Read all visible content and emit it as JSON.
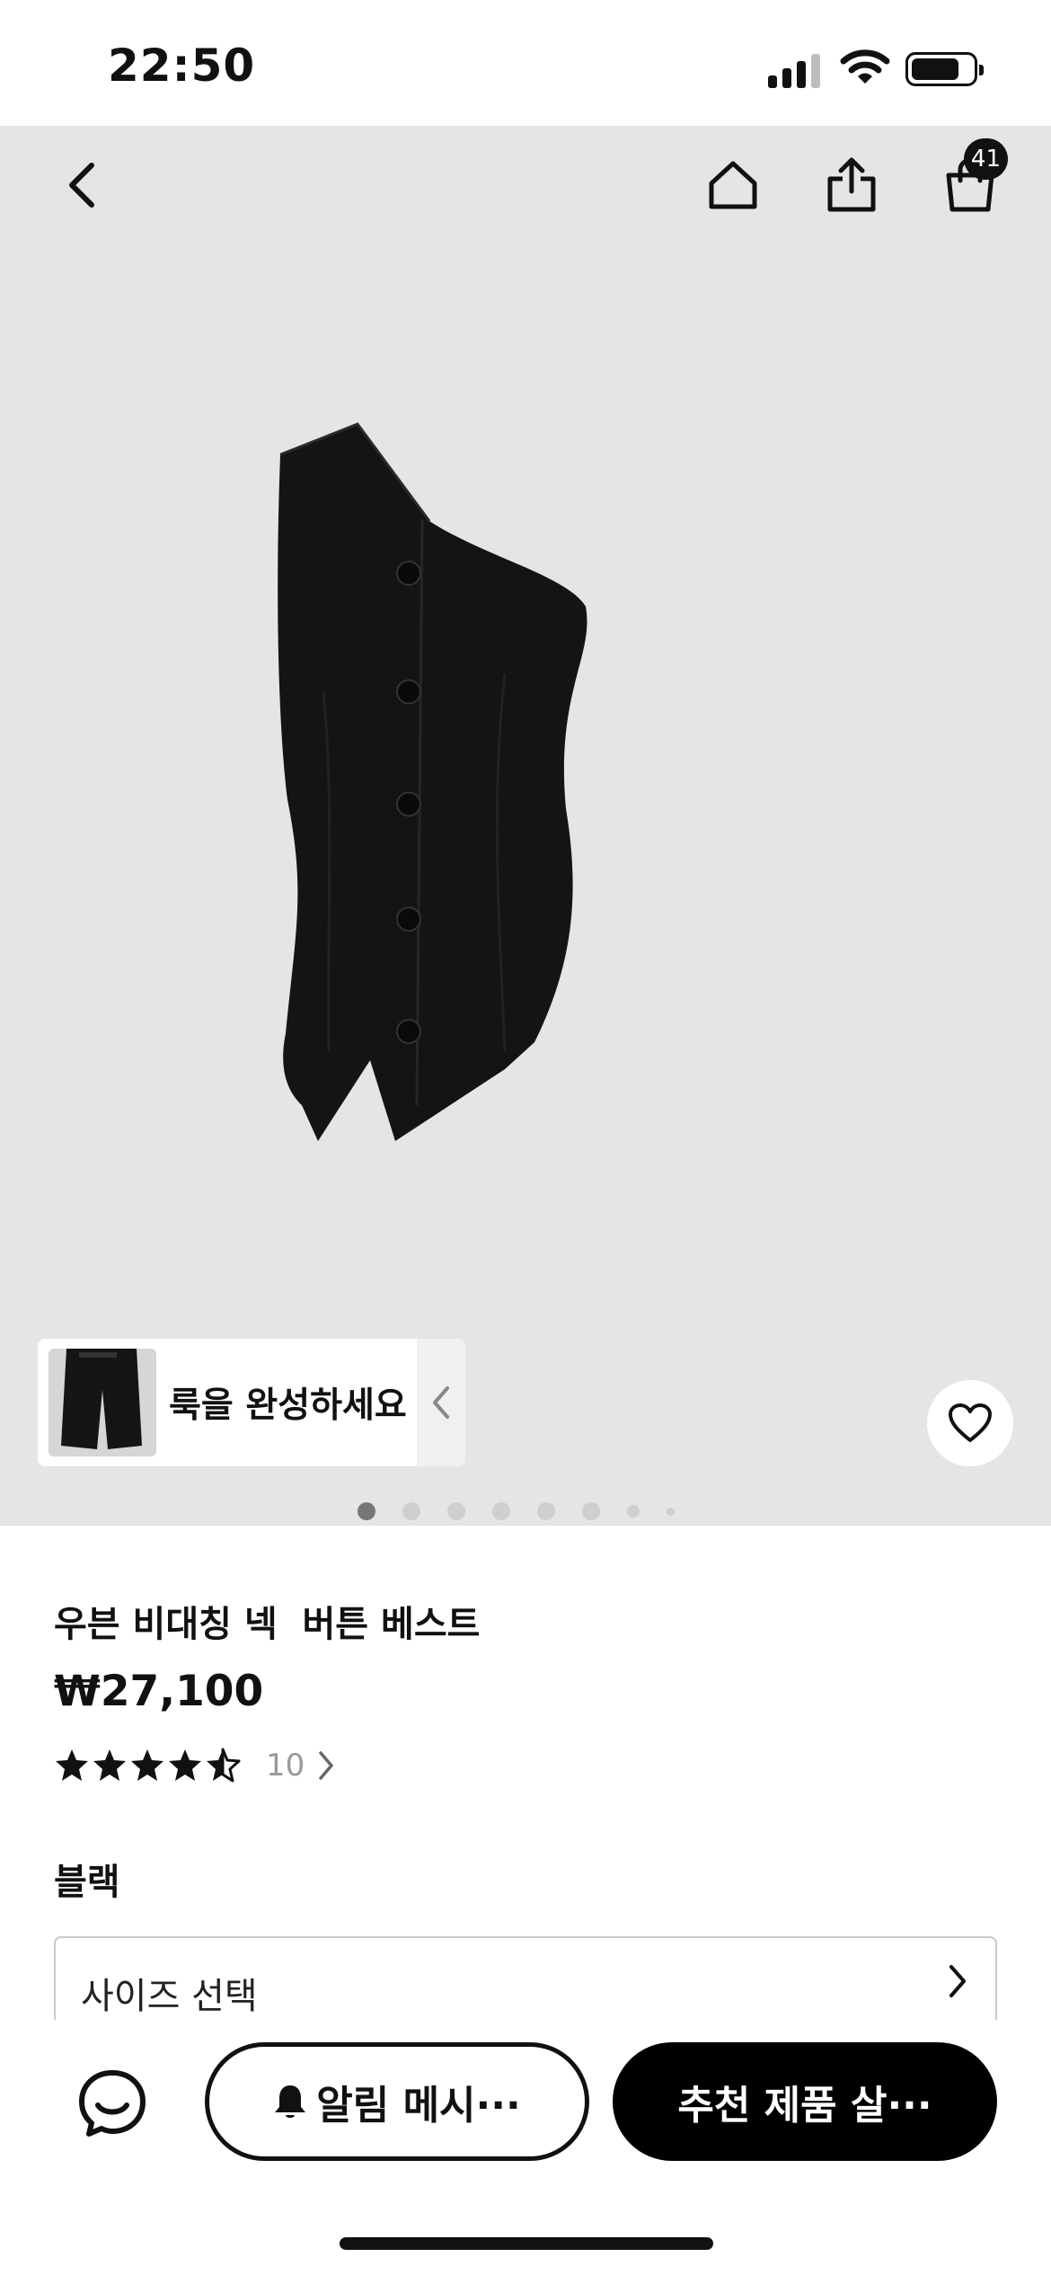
{
  "status_bar": {
    "time": "22:50"
  },
  "header": {
    "cart_count": "41"
  },
  "gallery": {
    "look_label": "룩을 완성하세요",
    "page_count": 8,
    "active_page": 1
  },
  "product": {
    "title": "우븐 비대칭 넥  버튼 베스트",
    "price": "₩27,100",
    "rating": 4.5,
    "review_count": "10",
    "color": "블랙",
    "size_placeholder": "사이즈 선택"
  },
  "actions": {
    "notify_label": "알림 메시···",
    "recommend_label": "추천 제품 살···"
  },
  "icons": {
    "back": "back-icon",
    "home": "home-icon",
    "share": "share-icon",
    "cart": "shopping-bag-icon",
    "heart": "heart-icon",
    "chat": "chat-icon",
    "bell": "bell-icon"
  },
  "colors": {
    "accent": "#000000",
    "gallery_bg": "#e5e5e5"
  }
}
